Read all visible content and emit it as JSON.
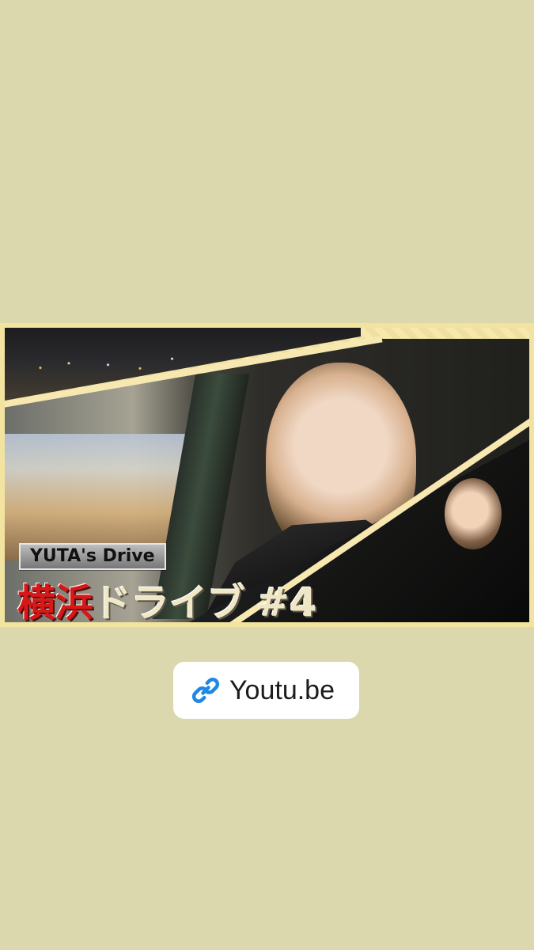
{
  "thumbnail": {
    "series_tag": "YUTA's Drive",
    "title_red": "横浜",
    "title_rest": "ドライブ",
    "episode": "#4"
  },
  "link": {
    "label": "Youtu.be",
    "icon": "link-icon"
  },
  "colors": {
    "background": "#dcd8ae",
    "link_icon": "#1e88e5",
    "title_red": "#d91717"
  }
}
